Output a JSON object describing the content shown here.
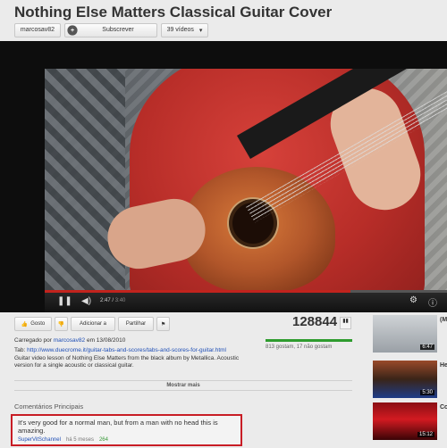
{
  "header": {
    "title": "Nothing Else Matters Classical Guitar Cover",
    "channel": "marcosav82",
    "subscribe_label": "Subscrever",
    "videos_label": "39 vídeos"
  },
  "player": {
    "current_time": "2:47",
    "duration": "3:40",
    "progress": 0.76
  },
  "actions": {
    "like_label": "Gosto",
    "add_label": "Adicionar a",
    "share_label": "Partilhar"
  },
  "stats": {
    "views": "128844",
    "likes_text": "813 gostam, 17 não gostam"
  },
  "description": {
    "uploaded_prefix": "Carregado por",
    "uploader": "marcosav82",
    "uploaded_suffix": "em 13/08/2010",
    "tab_label": "Tab:",
    "tab_link": "http://www.duecrome.it/guitar-tabs-and-scores/tabs-and-scores-for-guitar.html",
    "body": "Guitar video lesson of Nothing Else Matters from the black album by Metallica. Acoustic version for a single acoustic or classical guitar.",
    "show_more": "Mostrar mais"
  },
  "comments": {
    "heading": "Comentários Principais",
    "top": {
      "text": "It's very good for a normal man, but from a man with no head this is amazing.",
      "user": "SuperVitSchannel",
      "age": "há 5 meses",
      "votes": "264"
    }
  },
  "sidebar": {
    "items": [
      {
        "duration": "6:47",
        "label": "(M M"
      },
      {
        "duration": "5:30",
        "label": "He"
      },
      {
        "duration": "15:12",
        "label": "Co Za"
      }
    ]
  },
  "colors": {
    "comment_highlight": "#c81d25",
    "link": "#1f4fb6",
    "progress": "#c2231d",
    "like_bar": "#2e9c2e"
  }
}
